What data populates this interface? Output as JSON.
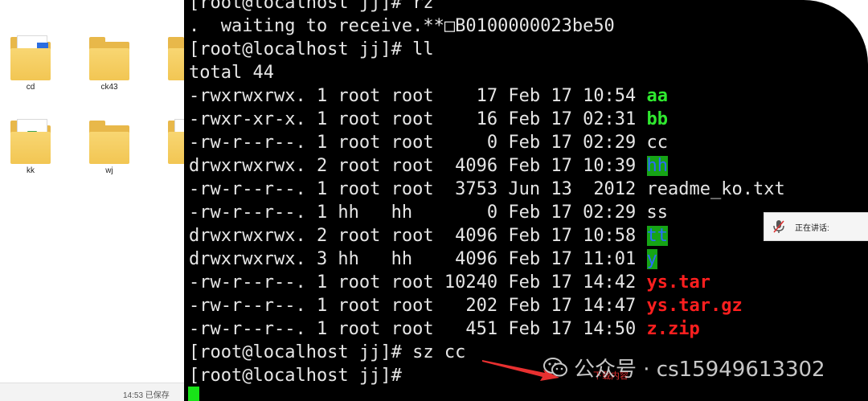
{
  "explorer": {
    "items": [
      {
        "label": "cd",
        "kind": "folder-with-docs"
      },
      {
        "label": "ck43",
        "kind": "folder"
      },
      {
        "label": "",
        "kind": "folder"
      },
      {
        "label": "kk",
        "kind": "folder-with-excel"
      },
      {
        "label": "wj",
        "kind": "folder"
      },
      {
        "label": "",
        "kind": "folder-with-excel"
      }
    ],
    "status": "14:53  已保存"
  },
  "terminal": {
    "lines": [
      {
        "text": "[root@localhost jj]# rz"
      },
      {
        "text": ".  waiting to receive.**□B0100000023be50"
      },
      {
        "text": "[root@localhost jj]# ll"
      },
      {
        "text": "total 44"
      },
      {
        "text": "-rwxrwxrwx. 1 root root    17 Feb 17 10:54 ",
        "file": "aa",
        "style": "green"
      },
      {
        "text": "-rwxr-xr-x. 1 root root    16 Feb 17 02:31 ",
        "file": "bb",
        "style": "green"
      },
      {
        "text": "-rw-r--r--. 1 root root     0 Feb 17 02:29 ",
        "file": "cc",
        "style": "plain"
      },
      {
        "text": "drwxrwxrwx. 2 root root  4096 Feb 17 10:39 ",
        "file": "hh",
        "style": "dir"
      },
      {
        "text": "-rw-r--r--. 1 root root  3753 Jun 13  2012 ",
        "file": "readme_ko.txt",
        "style": "plain"
      },
      {
        "text": "-rw-r--r--. 1 hh   hh       0 Feb 17 02:29 ",
        "file": "ss",
        "style": "plain"
      },
      {
        "text": "drwxrwxrwx. 2 root root  4096 Feb 17 10:58 ",
        "file": "tt",
        "style": "dir"
      },
      {
        "text": "drwxrwxrwx. 3 hh   hh    4096 Feb 17 11:01 ",
        "file": "y",
        "style": "dir"
      },
      {
        "text": "-rw-r--r--. 1 root root 10240 Feb 17 14:42 ",
        "file": "ys.tar",
        "style": "red"
      },
      {
        "text": "-rw-r--r--. 1 root root   202 Feb 17 14:47 ",
        "file": "ys.tar.gz",
        "style": "red"
      },
      {
        "text": "-rw-r--r--. 1 root root   451 Feb 17 14:50 ",
        "file": "z.zip",
        "style": "red"
      },
      {
        "text": "[root@localhost jj]# sz cc"
      },
      {
        "text": "[root@localhost jj]#"
      }
    ],
    "colors": {
      "background": "#000000",
      "text": "#e6e6e6",
      "executable": "#2fe82f",
      "archive": "#ff1f1f",
      "directory_fg": "#2a6cff",
      "directory_bg": "#16a416",
      "cursor": "#18e318"
    }
  },
  "speaking_popup": {
    "icon": "microphone-icon",
    "text": "正在讲话:"
  },
  "annotation": {
    "label": "下载内容",
    "color": "#e03030"
  },
  "watermark": {
    "icon": "wechat-icon",
    "text": "公众号 · cs15949613302"
  }
}
